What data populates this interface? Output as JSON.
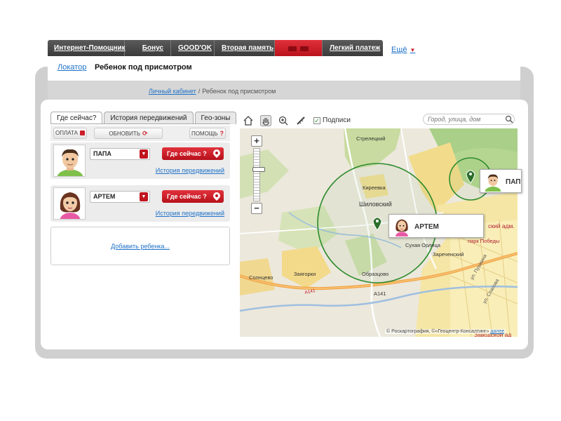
{
  "topnav": {
    "tabs": [
      {
        "label": "Интернет-Помощник"
      },
      {
        "label": "Бонус"
      },
      {
        "label": "GOOD'OK"
      },
      {
        "label": "Вторая память"
      },
      {
        "label": "Легкий платеж"
      }
    ],
    "more": "Ещё"
  },
  "subnav": {
    "link": "Локатор",
    "current": "Ребенок под присмотром"
  },
  "breadcrumb": {
    "link": "Личный кабинет",
    "sep": "/",
    "current": "Ребенок под присмотром"
  },
  "tabs": [
    "Где сейчас?",
    "История передвижений",
    "Гео-зоны"
  ],
  "toolbar": {
    "pay": "ОПЛАТА",
    "refresh": "ОБНОВИТЬ",
    "help": "ПОМОЩЬ",
    "help_icon": "?",
    "refresh_icon": "⟳"
  },
  "children": [
    {
      "name": "ПАПА",
      "where_btn": "Где сейчас ?",
      "history": "История передвижений"
    },
    {
      "name": "АРТЕМ",
      "where_btn": "Где сейчас ?",
      "history": "История передвижений"
    }
  ],
  "add_child": "Добавить ребенка...",
  "map": {
    "labels_toggle": "Подписи",
    "search_placeholder": "Город, улица, дом",
    "places": {
      "strelecky": "Стрелецкий",
      "kireevka": "Киреевка",
      "shilovsky": "Шиловский",
      "sukhaya_orlitsa": "Сухая Орлица",
      "zarechensky": "Зареченский",
      "zayagorka": "Заягорки",
      "solntsevo": "Солнцево",
      "obraztsovo": "Образцово",
      "a141_a": "А141",
      "a141_b": "А141",
      "adm": "ский адм.",
      "park": "парк Победы",
      "street1": "ул. Пушкина",
      "street2": "ул. Спасова",
      "zavodskoy": "Заводской ад"
    },
    "balloons": [
      {
        "name": "АРТЕМ"
      },
      {
        "name": "ПАП"
      }
    ],
    "copyright": "© Роскартография, ©«Геоцентр-Консалтинг»",
    "copyright_link": "далее"
  },
  "colors": {
    "accent": "#cc1f2a",
    "link": "#1f72c8",
    "nav_bg": "#3a3a3a",
    "circle": "#2e8b2e"
  }
}
